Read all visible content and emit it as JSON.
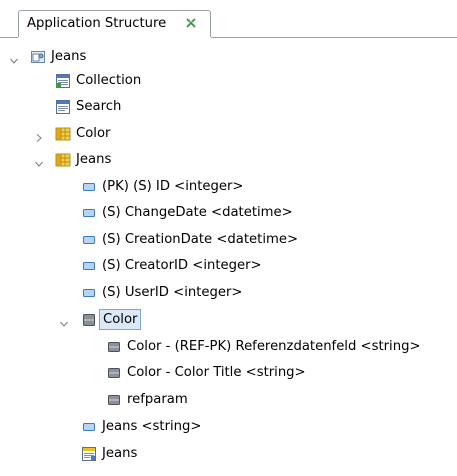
{
  "tab": {
    "title": "Application Structure",
    "close_icon": "close-icon"
  },
  "tree": {
    "root": {
      "label": "Jeans",
      "expanded": true
    },
    "collection": {
      "label": "Collection"
    },
    "search": {
      "label": "Search"
    },
    "color_table": {
      "label": "Color",
      "expanded": false
    },
    "jeans_table": {
      "label": "Jeans",
      "expanded": true
    },
    "fields": [
      {
        "label": "(PK) (S) ID <integer>"
      },
      {
        "label": "(S) ChangeDate <datetime>"
      },
      {
        "label": "(S) CreationDate <datetime>"
      },
      {
        "label": "(S) CreatorID <integer>"
      },
      {
        "label": "(S) UserID <integer>"
      }
    ],
    "color_ref": {
      "label": "Color",
      "expanded": true,
      "selected": true
    },
    "color_ref_fields": [
      {
        "label": "Color - (REF-PK) Referenzdatenfeld <string>"
      },
      {
        "label": "Color - Color Title <string>"
      },
      {
        "label": "refparam"
      }
    ],
    "jeans_string": {
      "label": "Jeans <string>"
    },
    "jeans_form": {
      "label": "Jeans"
    }
  },
  "colors": {
    "field_icon": "#3a78c8",
    "ref_icon": "#6b6f78",
    "selection_bg": "#dbe8f7",
    "selection_border": "#7ea6d6",
    "table_icon": "#e8b71a"
  }
}
